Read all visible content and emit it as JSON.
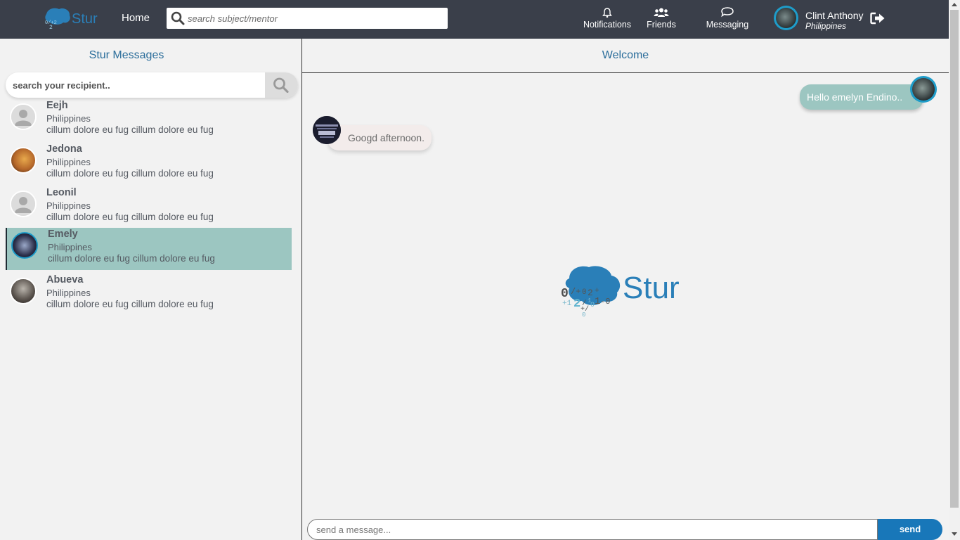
{
  "header": {
    "logo_text": "Stur",
    "home_label": "Home",
    "search_placeholder": "search subject/mentor",
    "nav": [
      {
        "label": "Notifications",
        "icon": "bell-icon"
      },
      {
        "label": "Friends",
        "icon": "users-icon"
      },
      {
        "label": "Messaging",
        "icon": "chat-icon"
      }
    ],
    "user": {
      "name": "Clint Anthony",
      "country": "Philippines"
    }
  },
  "sidebar": {
    "title": "Stur Messages",
    "search_placeholder": "search your recipient..",
    "contacts": [
      {
        "name": "Eejh",
        "country": "Philippines",
        "preview": "cillum dolore eu fug cillum dolore eu fug",
        "active": false
      },
      {
        "name": "Jedona",
        "country": "Philippines",
        "preview": "cillum dolore eu fug cillum dolore eu fug",
        "active": false
      },
      {
        "name": "Leonil",
        "country": "Philippines",
        "preview": "cillum dolore eu fug cillum dolore eu fug",
        "active": false
      },
      {
        "name": "Emely",
        "country": "Philippines",
        "preview": "cillum dolore eu fug cillum dolore eu fug",
        "active": true
      },
      {
        "name": "Abueva",
        "country": "Philippines",
        "preview": "cillum dolore eu fug cillum dolore eu fug",
        "active": false
      }
    ]
  },
  "chat": {
    "title": "Welcome",
    "messages": [
      {
        "direction": "outgoing",
        "text": "Hello emelyn Endino.."
      },
      {
        "direction": "incoming",
        "text": "Googd afternoon."
      }
    ],
    "logo_text": "Stur",
    "input_placeholder": "send a message...",
    "send_label": "send"
  },
  "colors": {
    "topbar": "#3a3f4a",
    "accent_blue": "#2c6e9b",
    "active_contact": "#9cc6c1",
    "send_button": "#1877b9"
  }
}
